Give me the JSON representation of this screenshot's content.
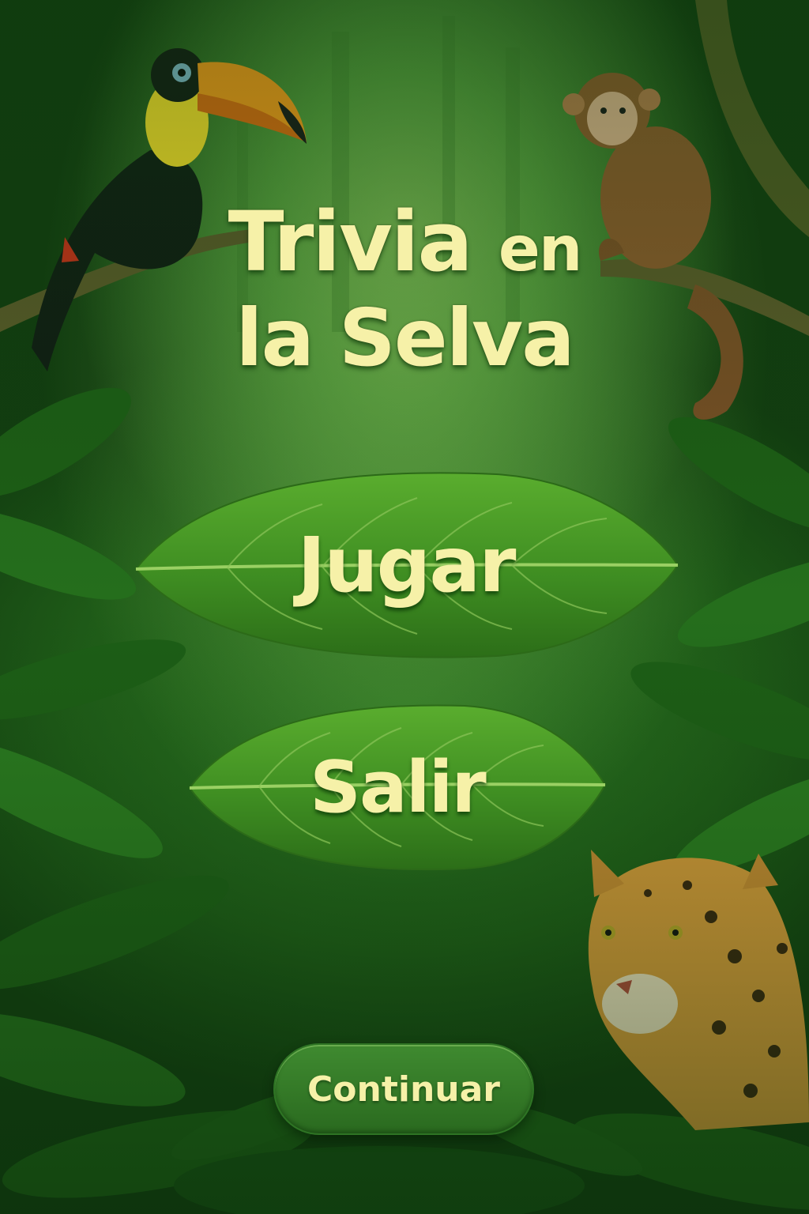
{
  "title": {
    "line1_main": "Trivia",
    "line1_small": "en",
    "line2": "la Selva"
  },
  "menu": {
    "play_label": "Jugar",
    "exit_label": "Salir",
    "continue_label": "Continuar"
  },
  "scene": {
    "animals": [
      "toucan",
      "monkey",
      "jaguar"
    ]
  },
  "colors": {
    "title_text": "#f6f1a8",
    "leaf_green": "#4c9a2a",
    "jungle_dark": "#1f5c18"
  }
}
